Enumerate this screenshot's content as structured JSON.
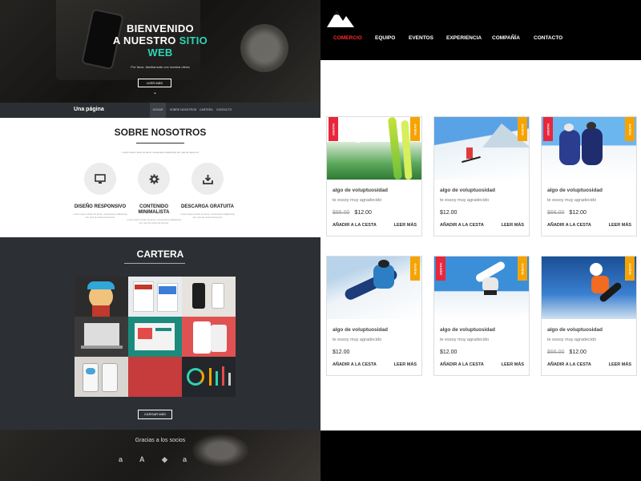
{
  "left": {
    "hero": {
      "title_line1": "BIENVENIDO",
      "title_line2_a": "A NUESTRO ",
      "title_line2_b": "SITIO",
      "title_line3": "WEB",
      "subtitle": "Por favor, familiarízate con nuestra oferta",
      "button": "LEER MÁS",
      "chevron": "⌄"
    },
    "subnav": {
      "brand": "Una página",
      "items": [
        "HOGAR",
        "SOBRE NOSOTROS",
        "CARTERA",
        "CONTACTO"
      ]
    },
    "about": {
      "title": "SOBRE NOSOTROS",
      "text": "Lorem ipsum dolor sit amet, consectetur adipiscing elit, sed do eiusmod",
      "features": [
        {
          "title": "DISEÑO RESPONSIVO",
          "icon": "monitor-icon",
          "text": "Lorem ipsum dolor sit amet, consectetur adipiscing elit, sed do eiusmod tempor"
        },
        {
          "title": "CONTENIDO MINIMALISTA",
          "icon": "gear-icon",
          "text": "Lorem ipsum dolor sit amet, consectetur adipiscing elit, sed do eiusmod tempor"
        },
        {
          "title": "DESCARGA GRATUITA",
          "icon": "download-icon",
          "text": "Lorem ipsum dolor sit amet, consectetur adipiscing elit, sed do eiusmod tempor"
        }
      ]
    },
    "portfolio": {
      "title": "CARTERA",
      "button": "CARGAR MÁS"
    },
    "partners": {
      "title": "Gracias a los socios",
      "logos": [
        "a",
        "A",
        "◆",
        "a"
      ]
    }
  },
  "right": {
    "nav": [
      "COMERCIO",
      "EQUIPO",
      "EVENTOS",
      "EXPERIENCIA",
      "COMPAÑÍA",
      "CONTACTO"
    ],
    "products": [
      {
        "title": "algo de voluptuosidad",
        "subtitle": "te essoy muy agradecido",
        "old_price": "$66.00",
        "price": "$12.00",
        "add": "AÑADIR A LA CESTA",
        "more": "LEER MÁS",
        "sale_badge": "¡VENTA!",
        "new_badge": "NUEVO"
      },
      {
        "title": "algo de voluptuosidad",
        "subtitle": "te essoy muy agradecido",
        "old_price": "",
        "price": "$12.00",
        "add": "AÑADIR A LA CESTA",
        "more": "LEER MÁS",
        "sale_badge": "",
        "new_badge": "NUEVO"
      },
      {
        "title": "algo de voluptuosidad",
        "subtitle": "te essoy muy agradecido",
        "old_price": "$66.00",
        "price": "$12.00",
        "add": "AÑADIR A LA CESTA",
        "more": "LEER MÁS",
        "sale_badge": "¡VENTA!",
        "new_badge": "NUEVO"
      },
      {
        "title": "algo de voluptuosidad",
        "subtitle": "te essoy muy agradecido",
        "old_price": "",
        "price": "$12.00",
        "add": "AÑADIR A LA CESTA",
        "more": "LEER MÁS",
        "sale_badge": "",
        "new_badge": "NUEVO"
      },
      {
        "title": "algo de voluptuosidad",
        "subtitle": "te essoy muy agradecido",
        "old_price": "",
        "price": "$12.00",
        "add": "AÑADIR A LA CESTA",
        "more": "LEER MÁS",
        "sale_badge": "¡VENTA!",
        "new_badge": "NUEVO"
      },
      {
        "title": "algo de voluptuosidad",
        "subtitle": "te essoy muy agradecido",
        "old_price": "$66.00",
        "price": "$12.00",
        "add": "AÑADIR A LA CESTA",
        "more": "LEER MÁS",
        "sale_badge": "",
        "new_badge": "NUEVO"
      }
    ]
  },
  "colors": {
    "accent_teal": "#2fd4b4",
    "nav_active_red": "#ff2b2b",
    "sale_red": "#e8263c",
    "new_orange": "#f5a300",
    "dark_section": "#2c3034"
  }
}
